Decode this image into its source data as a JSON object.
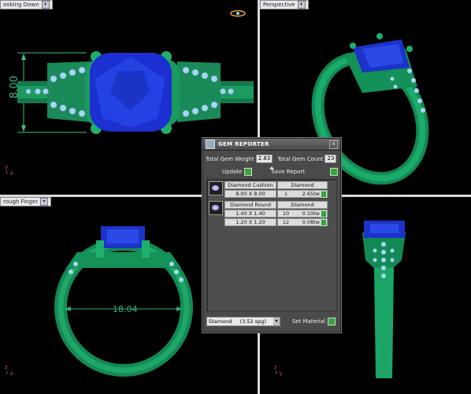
{
  "viewports": {
    "top_left": {
      "label": "ooking Down"
    },
    "top_right": {
      "label": "Perspective"
    },
    "bottom_left": {
      "label": "rough Finger"
    },
    "dimensions": {
      "height": "8.00",
      "diameter": "18.04"
    }
  },
  "axes": {
    "x": "x",
    "y": "y",
    "z": "z"
  },
  "gem_reporter": {
    "title": "Gem Reporter",
    "total_gem_weight_label": "Total Gem Weight",
    "total_gem_weight": "2.83",
    "total_gem_count_label": "Total Gem Count",
    "total_gem_count": "23",
    "update_label": "Update",
    "save_report_label": "Save Report",
    "gems": [
      {
        "name": "Diamond Cushion",
        "material": "Diamond",
        "rows": [
          {
            "size": "8.00 X 8.00",
            "count": "1",
            "weight": "2.65tw"
          }
        ]
      },
      {
        "name": "Diamond Round",
        "material": "Diamond",
        "rows": [
          {
            "size": "1.40 X 1.40",
            "count": "10",
            "weight": "0.10tw"
          },
          {
            "size": "1.20 X 1.20",
            "count": "12",
            "weight": "0.08tw"
          }
        ]
      }
    ],
    "material_select": "Diamond     (3.52 spg)",
    "set_material_label": "Set Material"
  }
}
